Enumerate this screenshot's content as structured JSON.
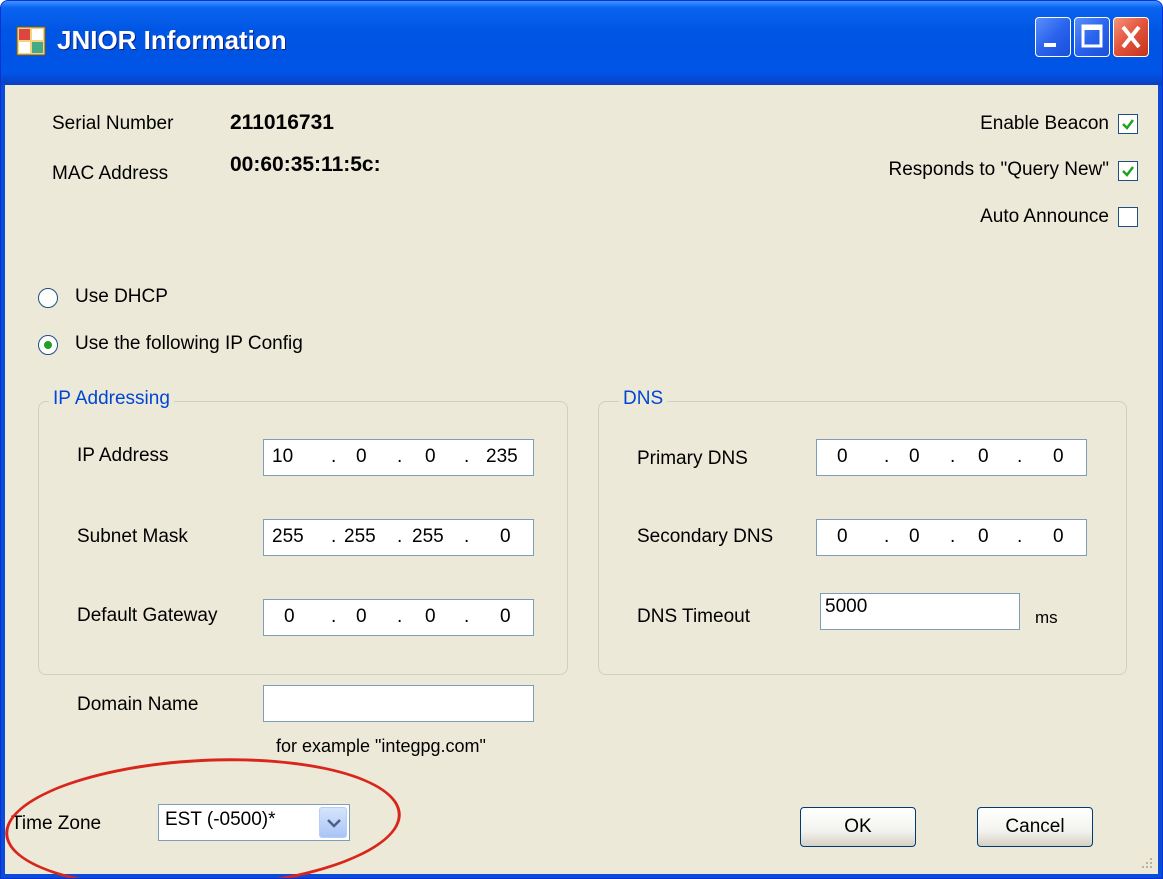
{
  "window": {
    "title": "JNIOR Information"
  },
  "info": {
    "serial_label": "Serial Number",
    "serial_value": "211016731",
    "mac_label": "MAC Address",
    "mac_value": "00:60:35:11:5c:"
  },
  "options": [
    {
      "label": "Enable Beacon",
      "checked": true
    },
    {
      "label": "Responds to \"Query New\"",
      "checked": true
    },
    {
      "label": "Auto Announce",
      "checked": false
    }
  ],
  "radio": {
    "dhcp_label": "Use DHCP",
    "static_label": "Use the following IP Config",
    "selected": "static"
  },
  "ip_group": {
    "title": "IP Addressing",
    "ip_label": "IP Address",
    "ip": [
      "10",
      "0",
      "0",
      "235"
    ],
    "subnet_label": "Subnet Mask",
    "subnet": [
      "255",
      "255",
      "255",
      "0"
    ],
    "gateway_label": "Default Gateway",
    "gateway": [
      "0",
      "0",
      "0",
      "0"
    ]
  },
  "dns_group": {
    "title": "DNS",
    "primary_label": "Primary DNS",
    "primary": [
      "0",
      "0",
      "0",
      "0"
    ],
    "secondary_label": "Secondary DNS",
    "secondary": [
      "0",
      "0",
      "0",
      "0"
    ],
    "timeout_label": "DNS Timeout",
    "timeout_value": "5000",
    "timeout_unit": "ms"
  },
  "domain": {
    "label": "Domain Name",
    "value": "",
    "hint": "for example \"integpg.com\""
  },
  "timezone": {
    "label": "Time Zone",
    "value": "EST (-0500)*"
  },
  "buttons": {
    "ok": "OK",
    "cancel": "Cancel"
  },
  "annotation": {
    "color": "#d9261c",
    "shape": "ellipse"
  }
}
